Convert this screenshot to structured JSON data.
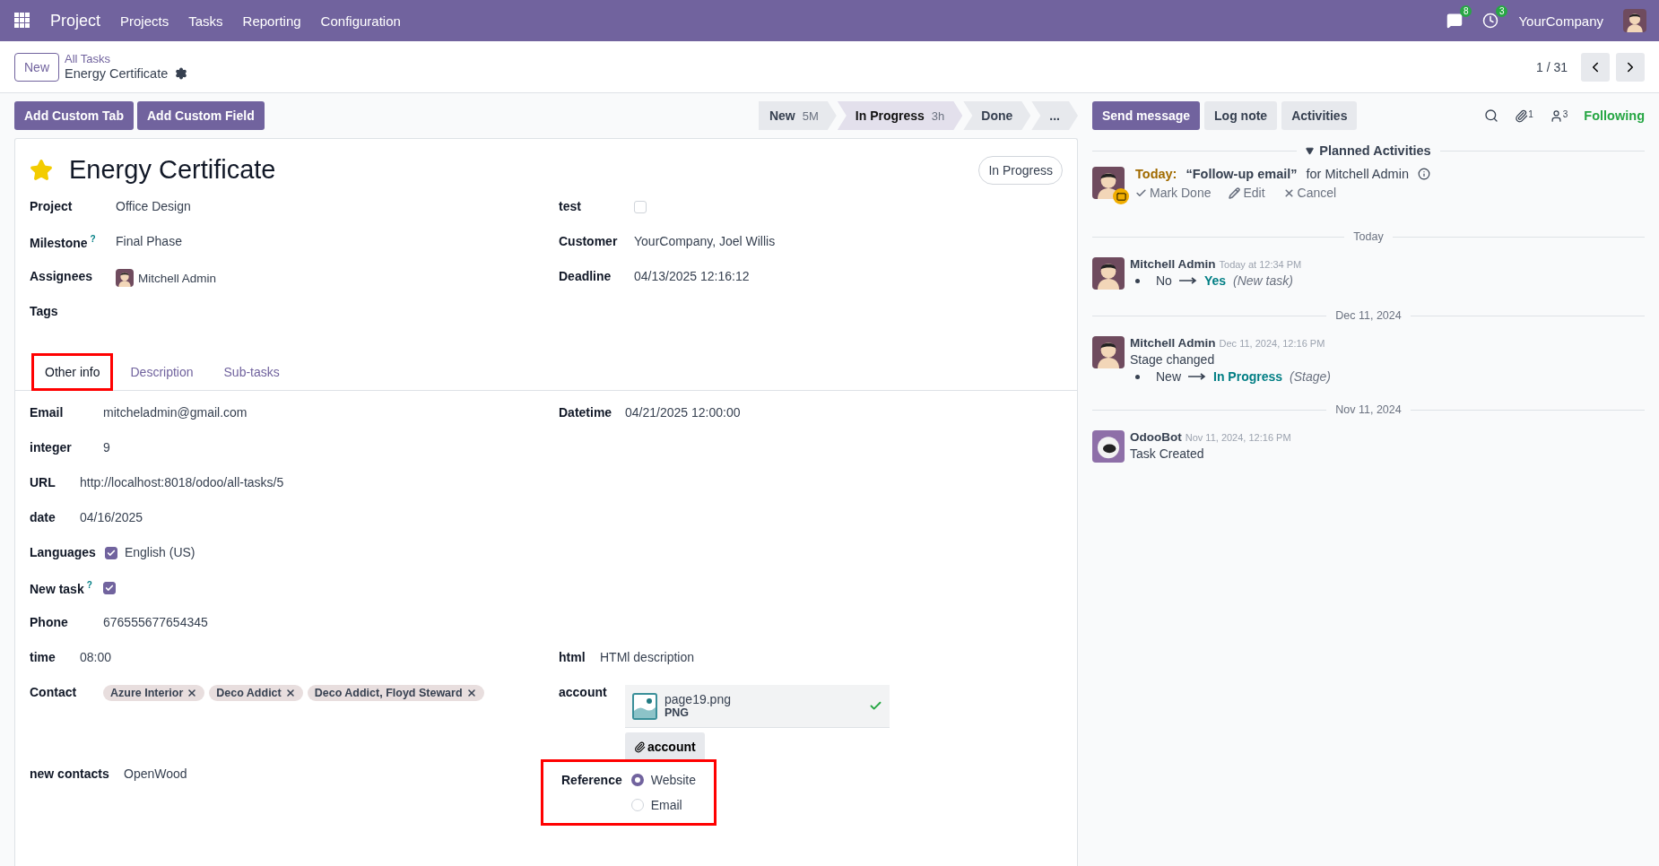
{
  "navbar": {
    "app": "Project",
    "menus": [
      "Projects",
      "Tasks",
      "Reporting",
      "Configuration"
    ],
    "messages_badge": "8",
    "activities_badge": "3",
    "company": "YourCompany"
  },
  "control_panel": {
    "new_button": "New",
    "breadcrumb_parent": "All Tasks",
    "breadcrumb_current": "Energy Certificate",
    "pager": "1 / 31"
  },
  "actions": [
    "Add Custom Tab",
    "Add Custom Field"
  ],
  "stages": [
    {
      "label": "New",
      "duration": "5M",
      "selected": false
    },
    {
      "label": "In Progress",
      "duration": "3h",
      "selected": true
    },
    {
      "label": "Done",
      "selected": false
    },
    {
      "label": "...",
      "selected": false
    }
  ],
  "form": {
    "starred": true,
    "title": "Energy Certificate",
    "stage_badge": "In Progress",
    "left_fields": [
      {
        "label": "Project",
        "kind": "text",
        "value": "Office Design"
      },
      {
        "label": "Milestone",
        "help": "?",
        "kind": "text",
        "value": "Final Phase"
      },
      {
        "label": "Assignees",
        "kind": "user",
        "value": "Mitchell Admin"
      },
      {
        "label": "Tags",
        "kind": "empty"
      }
    ],
    "right_fields": [
      {
        "label": "test",
        "kind": "checkbox",
        "checked": false
      },
      {
        "label": "Customer",
        "kind": "text",
        "value": "YourCompany, Joel Willis"
      },
      {
        "label": "Deadline",
        "kind": "text",
        "value": "04/13/2025 12:16:12"
      }
    ],
    "tabs": [
      {
        "label": "Other info",
        "selected": true,
        "highlighted": true
      },
      {
        "label": "Description",
        "selected": false,
        "highlighted": false
      },
      {
        "label": "Sub-tasks",
        "selected": false,
        "highlighted": false
      }
    ],
    "tab_left_fields": [
      {
        "label": "Email",
        "kind": "text",
        "value": "mitcheladmin@gmail.com"
      },
      {
        "label": "integer",
        "kind": "text",
        "value": "9"
      },
      {
        "label": "URL",
        "kind": "text",
        "value": "http://localhost:8018/odoo/all-tasks/5"
      },
      {
        "label": "date",
        "kind": "text",
        "value": "04/16/2025"
      },
      {
        "label": "Languages",
        "kind": "checkbox",
        "checked": true,
        "value": "English (US)"
      },
      {
        "label": "New task",
        "help": "?",
        "kind": "checkbox",
        "checked": true
      },
      {
        "label": "Phone",
        "kind": "text",
        "value": "676555677654345"
      },
      {
        "label": "time",
        "kind": "text",
        "value": "08:00"
      },
      {
        "label": "Contact",
        "kind": "tags",
        "tags": [
          "Azure Interior",
          "Deco Addict",
          "Deco Addict, Floyd Steward"
        ]
      },
      {
        "label": "new contacts",
        "kind": "text",
        "value": "OpenWood"
      }
    ],
    "tab_right_fields": [
      {
        "label": "Datetime",
        "kind": "text",
        "value": "04/21/2025 12:00:00"
      },
      {
        "label": "html",
        "kind": "text",
        "value": "HTMl description"
      },
      {
        "label": "account",
        "kind": "file",
        "file_name": "page19.png",
        "file_type": "PNG",
        "button": "account"
      },
      {
        "label": "Reference",
        "kind": "radio",
        "highlighted": true,
        "options": [
          {
            "label": "Website",
            "selected": true
          },
          {
            "label": "Email",
            "selected": false
          }
        ]
      }
    ]
  },
  "chatter": {
    "buttons": [
      {
        "label": "Send message",
        "kind": "primary"
      },
      {
        "label": "Log note",
        "kind": "secondary"
      },
      {
        "label": "Activities",
        "kind": "secondary"
      }
    ],
    "attachments_count": "1",
    "followers_count": "3",
    "follow_state": "Following",
    "planned_header": "Planned Activities",
    "activity": {
      "when": "Today:",
      "summary": "“Follow-up email”",
      "assignee": "for Mitchell Admin",
      "actions": [
        "Mark Done",
        "Edit",
        "Cancel"
      ]
    },
    "groups": [
      {
        "date": "Today",
        "messages": [
          {
            "author": "Mitchell Admin",
            "kind": "user",
            "time": "Today at 12:34 PM",
            "tracking": [
              {
                "old": "No",
                "new": "Yes",
                "field": "(New task)"
              }
            ]
          }
        ]
      },
      {
        "date": "Dec 11, 2024",
        "messages": [
          {
            "author": "Mitchell Admin",
            "kind": "user",
            "time": "Dec 11, 2024, 12:16 PM",
            "text": "Stage changed",
            "tracking": [
              {
                "old": "New",
                "new": "In Progress",
                "field": "(Stage)"
              }
            ]
          }
        ]
      },
      {
        "date": "Nov 11, 2024",
        "messages": [
          {
            "author": "OdooBot",
            "kind": "bot",
            "time": "Nov 11, 2024, 12:16 PM",
            "text": "Task Created"
          }
        ]
      }
    ]
  }
}
